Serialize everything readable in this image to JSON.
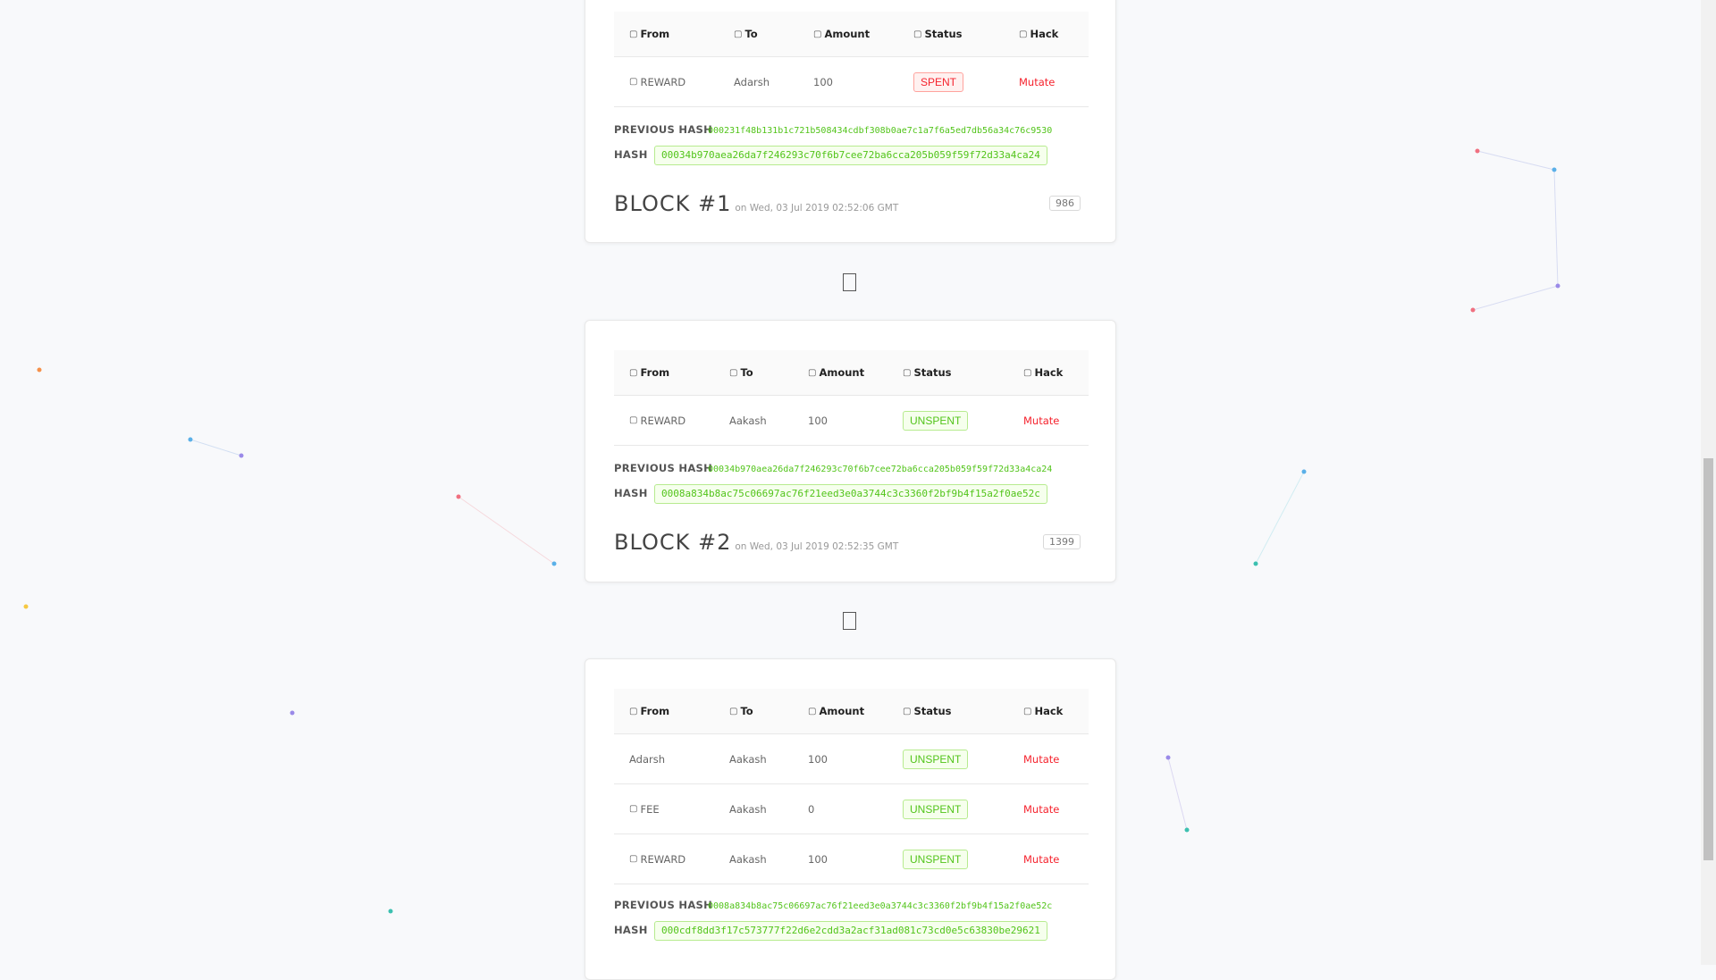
{
  "colors": {
    "accent_green": "#52c41a",
    "danger_red": "#f5222d",
    "background": "#f8f9fb"
  },
  "icons": {
    "column_header": "generic-icon",
    "coinbase": "generic-icon",
    "chain_arrow": "down-arrow-icon"
  },
  "table_headers": {
    "from": "From",
    "to": "To",
    "amount": "Amount",
    "status": "Status",
    "hack": "Hack"
  },
  "labels": {
    "previous_hash": "PREVIOUS HASH",
    "hash": "HASH",
    "mutate": "Mutate"
  },
  "blocks": [
    {
      "tx": [
        {
          "from": "REWARD",
          "to": "Adarsh",
          "amount": "100",
          "status": "SPENT",
          "action": "Mutate"
        }
      ],
      "previous_hash": "000231f48b131b1c721b508434cdbf308b0ae7c1a7f6a5ed7db56a34c76c9530",
      "hash": "00034b970aea26da7f246293c70f6b7cee72ba6cca205b059f59f72d33a4ca24",
      "title": "BLOCK #1",
      "date": "on Wed, 03 Jul 2019 02:52:06 GMT",
      "nonce": "986"
    },
    {
      "tx": [
        {
          "from": "REWARD",
          "to": "Aakash",
          "amount": "100",
          "status": "UNSPENT",
          "action": "Mutate"
        }
      ],
      "previous_hash": "00034b970aea26da7f246293c70f6b7cee72ba6cca205b059f59f72d33a4ca24",
      "hash": "0008a834b8ac75c06697ac76f21eed3e0a3744c3c3360f2bf9b4f15a2f0ae52c",
      "title": "BLOCK #2",
      "date": "on Wed, 03 Jul 2019 02:52:35 GMT",
      "nonce": "1399"
    },
    {
      "tx": [
        {
          "from": "Adarsh",
          "to": "Aakash",
          "amount": "100",
          "status": "UNSPENT",
          "action": "Mutate"
        },
        {
          "from": "FEE",
          "to": "Aakash",
          "amount": "0",
          "status": "UNSPENT",
          "action": "Mutate"
        },
        {
          "from": "REWARD",
          "to": "Aakash",
          "amount": "100",
          "status": "UNSPENT",
          "action": "Mutate"
        }
      ],
      "previous_hash": "0008a834b8ac75c06697ac76f21eed3e0a3744c3c3360f2bf9b4f15a2f0ae52c",
      "hash": "000cdf8dd3f17c573777f22d6e2cdd3a2acf31ad081c73cd0e5c63830be29621"
    }
  ]
}
